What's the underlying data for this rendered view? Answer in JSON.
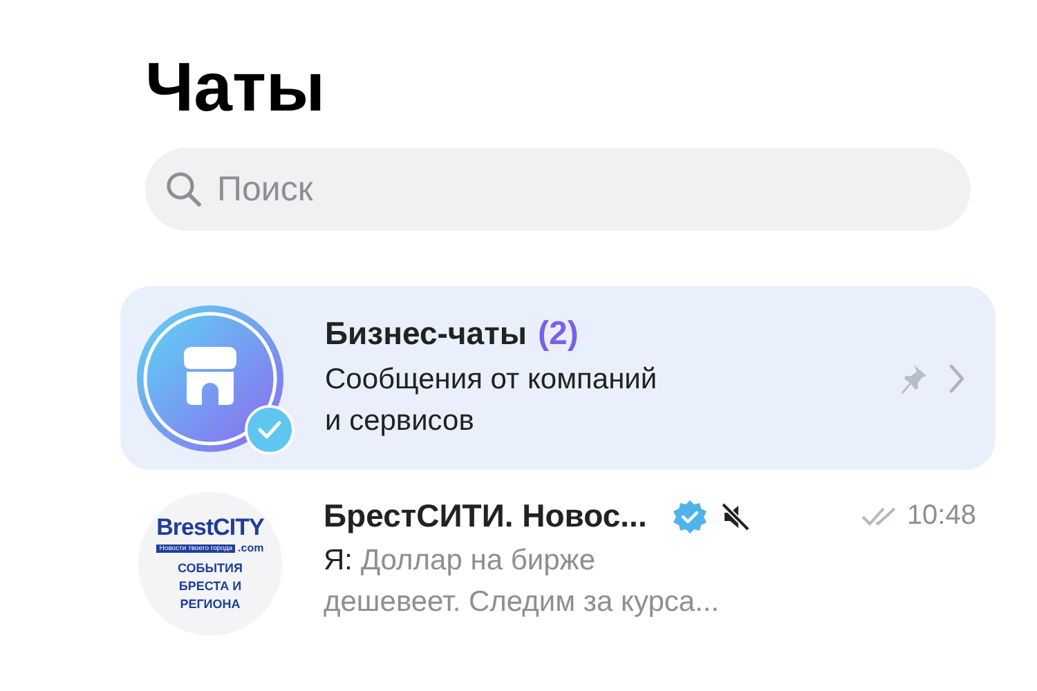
{
  "title": "Чаты",
  "search": {
    "placeholder": "Поиск"
  },
  "chats": [
    {
      "kind": "business",
      "selected": true,
      "title": "Бизнес-чаты",
      "count": "(2)",
      "subtitle": [
        "Сообщения от компаний",
        "и сервисов"
      ],
      "pinned": true,
      "verified": true
    },
    {
      "kind": "channel",
      "selected": false,
      "title": "БрестСИТИ. Новос...",
      "verified": true,
      "muted": true,
      "read": true,
      "time": "10:48",
      "sender": "Я:",
      "preview": [
        "Доллар на бирже",
        "дешевеет. Следим за курса..."
      ],
      "logo": {
        "brand": "BrestCITY",
        "tagline": "Новости твоего города",
        "domain": ".com",
        "caption": "СОБЫТИЯ БРЕСТА И РЕГИОНА"
      }
    }
  ]
}
